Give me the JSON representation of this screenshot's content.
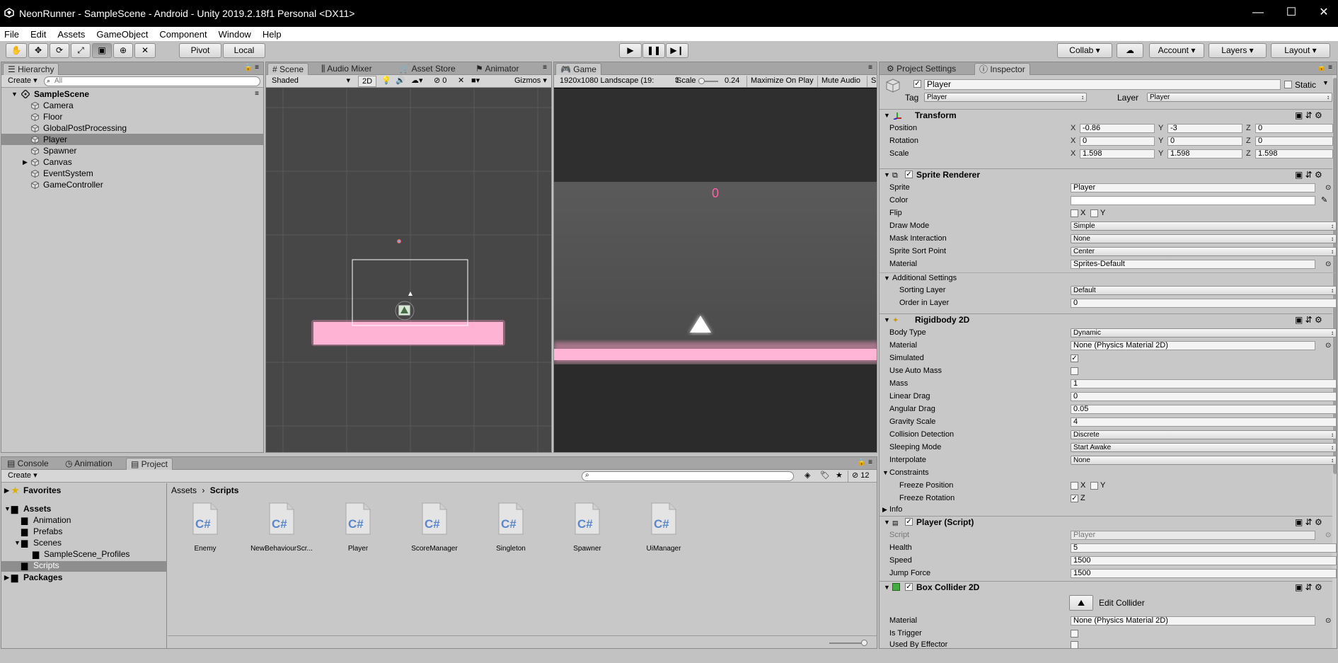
{
  "window": {
    "title": "NeonRunner - SampleScene - Android - Unity 2019.2.18f1 Personal <DX11>",
    "minimize": "—",
    "maximize": "☐",
    "close": "✕"
  },
  "menu": [
    "File",
    "Edit",
    "Assets",
    "GameObject",
    "Component",
    "Window",
    "Help"
  ],
  "toolbar": {
    "pivot": "Pivot",
    "local": "Local",
    "collab": "Collab ▾",
    "account": "Account",
    "layers": "Layers",
    "layout": "Layout"
  },
  "hierarchy": {
    "tab": "Hierarchy",
    "create": "Create",
    "search_placeholder": "All",
    "scene": "SampleScene",
    "items": [
      "Camera",
      "Floor",
      "GlobalPostProcessing",
      "Player",
      "Spawner",
      "Canvas",
      "EventSystem",
      "GameController"
    ],
    "selected": "Player"
  },
  "scene_view": {
    "tabs": [
      "Scene",
      "Audio Mixer",
      "Asset Store",
      "Animator"
    ],
    "shading": "Shaded",
    "mode_2d": "2D",
    "hidden_count": "0",
    "gizmos": "Gizmos"
  },
  "game_view": {
    "tab": "Game",
    "resolution": "1920x1080 Landscape (19:",
    "scale_label": "Scale",
    "scale_value": "0.24",
    "maximize_on_play": "Maximize On Play",
    "mute_audio": "Mute Audio",
    "stats": "S",
    "score": "0"
  },
  "bottom": {
    "tabs": [
      "Console",
      "Animation",
      "Project"
    ],
    "create": "Create",
    "hidden_count": "12",
    "breadcrumb_root": "Assets",
    "breadcrumb_current": "Scripts",
    "tree": {
      "favorites": "Favorites",
      "assets": "Assets",
      "animation": "Animation",
      "prefabs": "Prefabs",
      "scenes": "Scenes",
      "scene_profiles": "SampleScene_Profiles",
      "scripts": "Scripts",
      "packages": "Packages"
    },
    "files": [
      "Enemy",
      "NewBehaviourScr...",
      "Player",
      "ScoreManager",
      "Singleton",
      "Spawner",
      "UiManager"
    ],
    "file_glyph": "C#"
  },
  "inspector": {
    "tabs": [
      "Project Settings",
      "Inspector"
    ],
    "object_name": "Player",
    "static_label": "Static",
    "tag_label": "Tag",
    "tag_value": "Player",
    "layer_label": "Layer",
    "layer_value": "Player",
    "transform": {
      "title": "Transform",
      "position_label": "Position",
      "position": [
        "-0.86",
        "-3",
        "0"
      ],
      "rotation_label": "Rotation",
      "rotation": [
        "0",
        "0",
        "0"
      ],
      "scale_label": "Scale",
      "scale": [
        "1.598",
        "1.598",
        "1.598"
      ],
      "axes": [
        "X",
        "Y",
        "Z"
      ]
    },
    "sprite_renderer": {
      "title": "Sprite Renderer",
      "sprite_label": "Sprite",
      "sprite": "Player",
      "color_label": "Color",
      "flip_label": "Flip",
      "flip_x": "X",
      "flip_y": "Y",
      "draw_mode_label": "Draw Mode",
      "draw_mode": "Simple",
      "mask_label": "Mask Interaction",
      "mask": "None",
      "sort_point_label": "Sprite Sort Point",
      "sort_point": "Center",
      "material_label": "Material",
      "material": "Sprites-Default",
      "additional": "Additional Settings",
      "sorting_layer_label": "Sorting Layer",
      "sorting_layer": "Default",
      "order_label": "Order in Layer",
      "order": "0"
    },
    "rigidbody": {
      "title": "Rigidbody 2D",
      "body_type_label": "Body Type",
      "body_type": "Dynamic",
      "material_label": "Material",
      "material": "None (Physics Material 2D)",
      "simulated_label": "Simulated",
      "auto_mass_label": "Use Auto Mass",
      "mass_label": "Mass",
      "mass": "1",
      "linear_drag_label": "Linear Drag",
      "linear_drag": "0",
      "angular_drag_label": "Angular Drag",
      "angular_drag": "0.05",
      "gravity_label": "Gravity Scale",
      "gravity": "4",
      "collision_label": "Collision Detection",
      "collision": "Discrete",
      "sleeping_label": "Sleeping Mode",
      "sleeping": "Start Awake",
      "interpolate_label": "Interpolate",
      "interpolate": "None",
      "constraints": "Constraints",
      "freeze_pos_label": "Freeze Position",
      "fx": "X",
      "fy": "Y",
      "freeze_rot_label": "Freeze Rotation",
      "fz": "Z",
      "info": "Info"
    },
    "player_script": {
      "title": "Player (Script)",
      "script_label": "Script",
      "script": "Player",
      "health_label": "Health",
      "health": "5",
      "speed_label": "Speed",
      "speed": "1500",
      "jump_label": "Jump Force",
      "jump": "1500"
    },
    "box_collider": {
      "title": "Box Collider 2D",
      "edit": "Edit Collider",
      "material_label": "Material",
      "material": "None (Physics Material 2D)",
      "trigger_label": "Is Trigger",
      "effector_label": "Used By Effector"
    }
  },
  "colors": {
    "neon_pink": "#ff9fc8",
    "selection": "#8e8e8e",
    "scene_bg": "#474747"
  }
}
